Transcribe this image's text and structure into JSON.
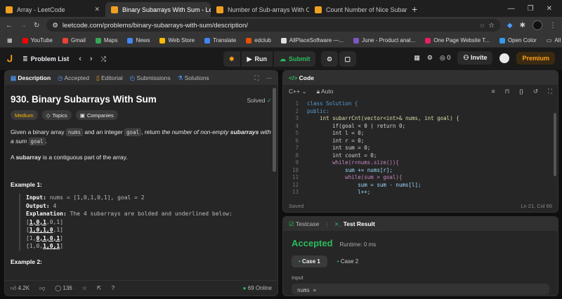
{
  "browser": {
    "tabs": [
      {
        "label": "Array - LeetCode",
        "fav": "#f0a021"
      },
      {
        "label": "Binary Subarrays With Sum - Le",
        "fav": "#f0a021"
      },
      {
        "label": "Number of Sub-arrays With Od",
        "fav": "#f0a021"
      },
      {
        "label": "Count Number of Nice Subarra",
        "fav": "#f0a021"
      }
    ],
    "url": "leetcode.com/problems/binary-subarrays-with-sum/description/",
    "bookmarks": [
      {
        "label": "YouTube",
        "color": "#ff0000"
      },
      {
        "label": "Gmail",
        "color": "#ea4335"
      },
      {
        "label": "Maps",
        "color": "#34a853"
      },
      {
        "label": "News",
        "color": "#4285f4"
      },
      {
        "label": "Web Store",
        "color": "#fbbc04"
      },
      {
        "label": "Translate",
        "color": "#4285f4"
      },
      {
        "label": "edclub",
        "color": "#e65100"
      },
      {
        "label": "AllPlaceSoftware —...",
        "color": "#e0e0e0"
      },
      {
        "label": "June - Product anal...",
        "color": "#7e57c2"
      },
      {
        "label": "One Page Website T...",
        "color": "#e91e63"
      },
      {
        "label": "Open Color",
        "color": "#339af0"
      }
    ],
    "all_bookmarks": "All Bookmarks"
  },
  "lc": {
    "problem_list": "Problem List",
    "run": "Run",
    "submit": "Submit",
    "streak": "0",
    "invite": "Invite",
    "premium": "Premium"
  },
  "left_tabs": [
    "Description",
    "Accepted",
    "Editorial",
    "Submissions",
    "Solutions"
  ],
  "problem": {
    "title": "930. Binary Subarrays With Sum",
    "solved": "Solved",
    "difficulty": "Medium",
    "topics": "Topics",
    "companies": "Companies",
    "p1": [
      "Given a binary array ",
      "nums",
      " and an integer ",
      "goal",
      ", return ",
      "the number of non-empty ",
      "subarrays",
      " with a sum ",
      "goal",
      "."
    ],
    "p2": [
      "A ",
      "subarray",
      " is a contiguous part of the array."
    ],
    "ex1_title": "Example 1:",
    "ex1_input_label": "Input:",
    "ex1_input": "nums = [1,0,1,0,1], goal = 2",
    "ex1_output_label": "Output:",
    "ex1_output": "4",
    "ex1_expl_label": "Explanation:",
    "ex1_expl": "The 4 subarrays are bolded and underlined below:",
    "ex1_lines": [
      [
        "[",
        "1,0,1",
        ",0,1]"
      ],
      [
        "[",
        "1,0,1,0",
        ",1]"
      ],
      [
        "[1,",
        "0,1,0,1",
        "]"
      ],
      [
        "[1,0,",
        "1,0,1",
        "]"
      ]
    ],
    "ex2_title": "Example 2:"
  },
  "footer": {
    "likes": "4.2K",
    "comments": "136",
    "online": "69 Online"
  },
  "code": {
    "tab": "Code",
    "lang": "C++",
    "mode": "Auto",
    "saved": "Saved",
    "pos": "Ln 21, Col 66",
    "lines": [
      "class Solution {",
      "public:",
      "    int subarrCnt(vector<int>& nums, int goal) {",
      "        if(goal < 0 ) return 0;",
      "        int l = 0;",
      "        int r = 0;",
      "        int sum = 0;",
      "        int count = 0;",
      "        while(r<nums.size()){",
      "            sum += nums[r];",
      "            while(sum > goal){",
      "                sum = sum - nums[l];",
      "                l++;"
    ]
  },
  "result": {
    "testcase": "Testcase",
    "test_result": "Test Result",
    "status": "Accepted",
    "runtime": "Runtime: 0 ms",
    "cases": [
      "Case 1",
      "Case 2"
    ],
    "input_label": "Input",
    "input_value": "nums ="
  },
  "colors": {
    "accent": "#2cbb5d",
    "orange": "#ffa116",
    "medium": "#ffb800"
  }
}
